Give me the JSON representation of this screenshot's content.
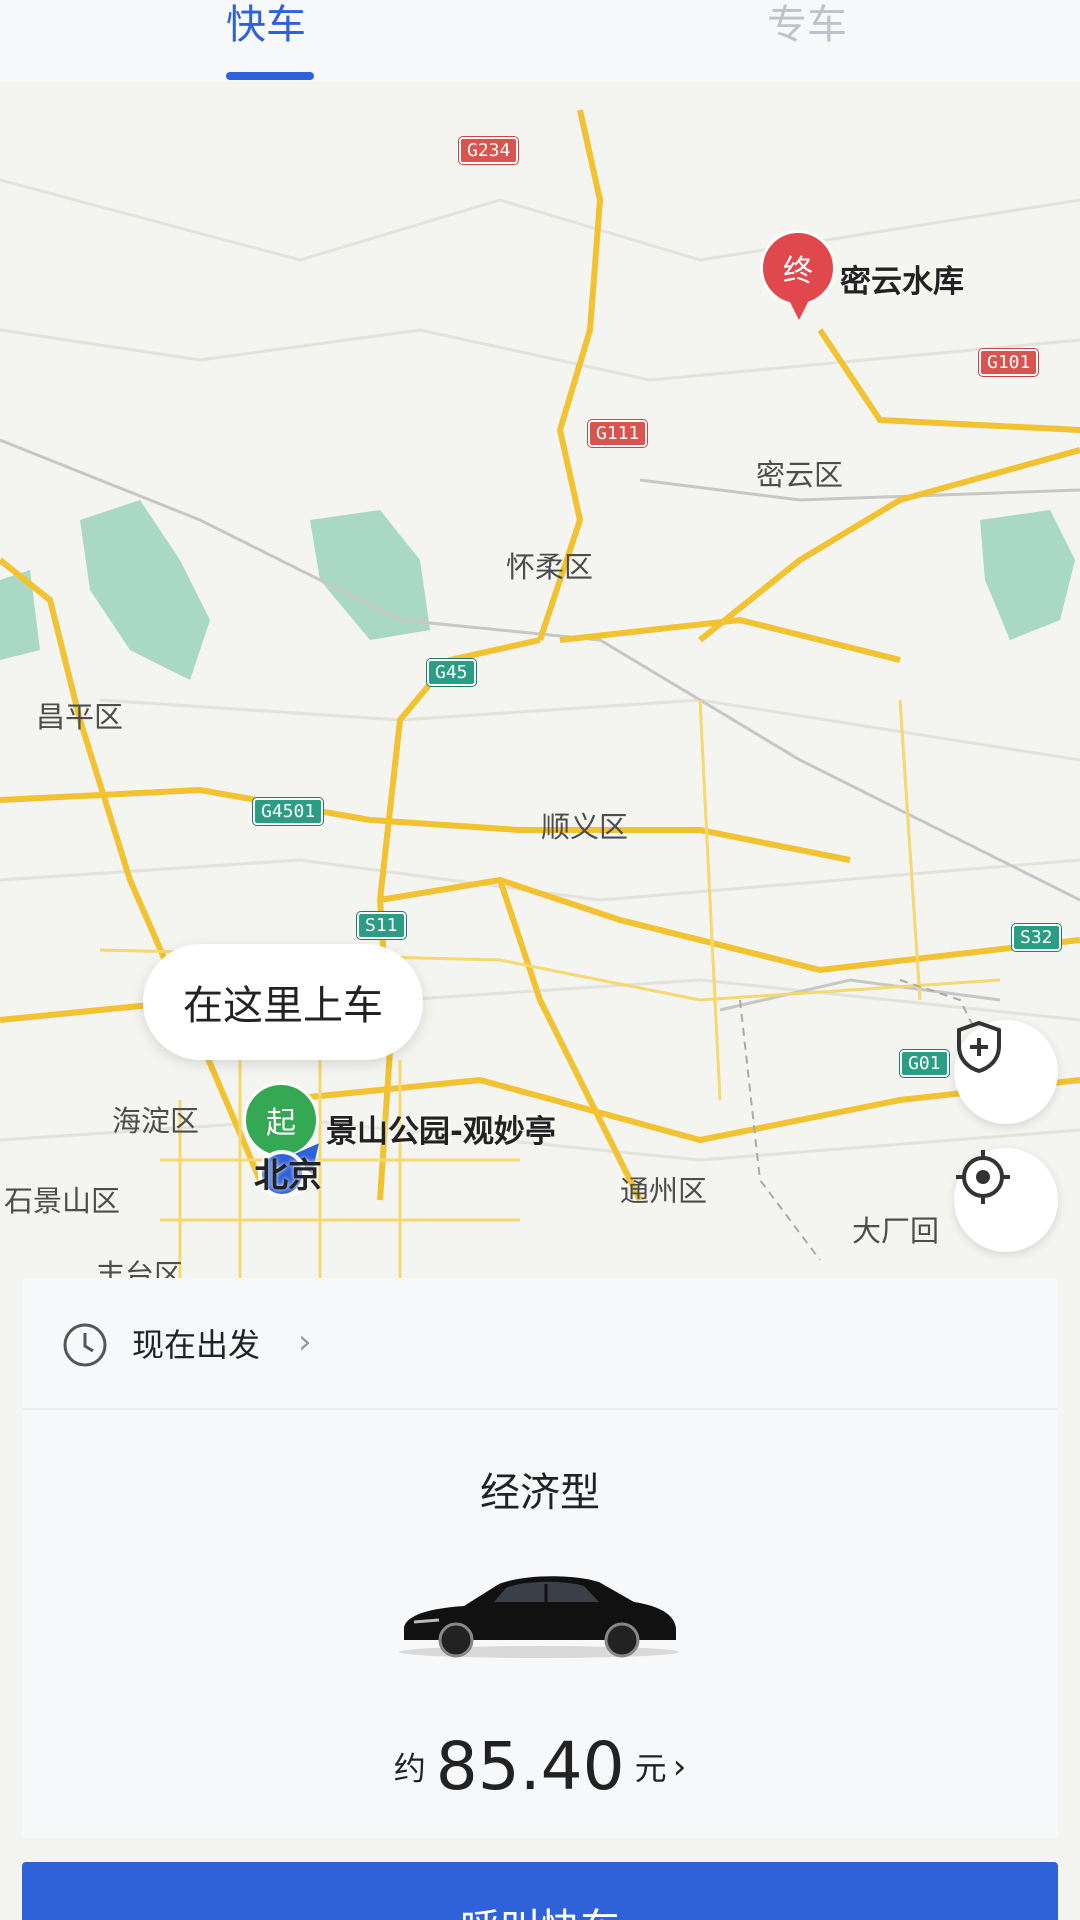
{
  "tabs": [
    {
      "label": "快车",
      "active": true
    },
    {
      "label": "专车",
      "active": false
    }
  ],
  "map": {
    "districts": [
      "昌平区",
      "怀柔区",
      "密云区",
      "顺义区",
      "海淀区",
      "石景山区",
      "丰台区",
      "通州区",
      "大厂回"
    ],
    "roads": [
      "G234",
      "G111",
      "G101",
      "G45",
      "G4501",
      "S11",
      "S32",
      "G01"
    ],
    "pickup_hint": "在这里上车",
    "start_pin": "起",
    "end_pin": "终",
    "start_poi": "景山公园-观妙亭",
    "end_poi": "密云水库",
    "city_label": "北京"
  },
  "panel": {
    "depart_label": "现在出发",
    "car_type": "经济型",
    "price_prefix": "约",
    "price_value": "85.40",
    "price_unit": "元"
  },
  "call_button": "呼叫快车",
  "colors": {
    "accent": "#2f62d8",
    "start": "#34a853",
    "end": "#e0484e"
  },
  "icons": [
    "clock-icon",
    "chevron-right-icon",
    "shield-plus-icon",
    "locate-icon",
    "car-image"
  ]
}
